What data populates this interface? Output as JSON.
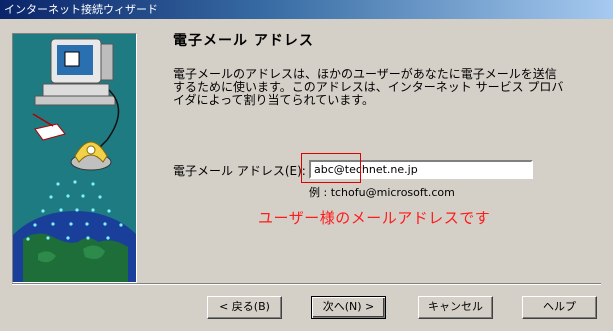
{
  "window": {
    "title": "インターネット接続ウィザード"
  },
  "page": {
    "heading": "電子メール アドレス",
    "description": "電子メールのアドレスは、ほかのユーザーがあなたに電子メールを送信するために使います。このアドレスは、インターネット サービス プロバイダによって割り当てられています。"
  },
  "form": {
    "email_label": "電子メール アドレス(E):",
    "email_value": "abc@technet.ne.jp",
    "example": "例 : tchofu@microsoft.com"
  },
  "annotation": {
    "text": "ユーザー様のメールアドレスです",
    "color": "#ff1a1a"
  },
  "buttons": {
    "back": "< 戻る(B)",
    "next": "次へ(N) >",
    "cancel": "キャンセル",
    "help": "ヘルプ"
  },
  "colors": {
    "titlebar_start": "#0a246a",
    "face": "#d4d0c8",
    "illustration_bg": "#1e7b82"
  }
}
